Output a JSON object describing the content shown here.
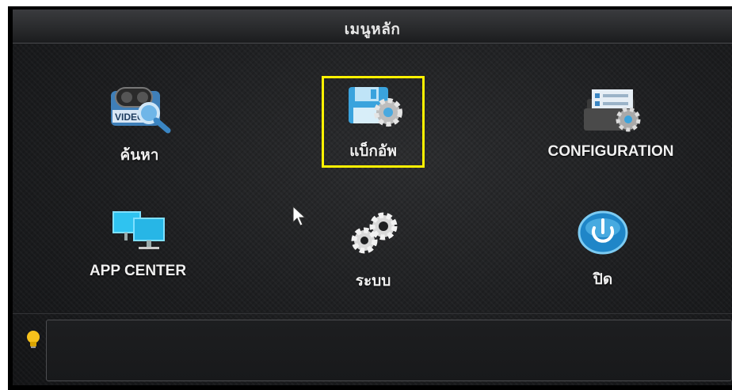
{
  "header": {
    "title": "เมนูหลัก"
  },
  "menu": {
    "items": [
      {
        "label": "ค้นหา"
      },
      {
        "label": "แบ็กอัพ"
      },
      {
        "label": "CONFIGURATION"
      },
      {
        "label": "APP CENTER"
      },
      {
        "label": "ระบบ"
      },
      {
        "label": "ปิด"
      }
    ]
  },
  "icons": {
    "video_search": "video-search-icon",
    "backup": "backup-icon",
    "configuration": "configuration-icon",
    "app_center": "app-center-icon",
    "system": "gears-icon",
    "power": "power-icon",
    "hint": "lightbulb-icon"
  },
  "colors": {
    "highlight": "#fff200",
    "accent_blue": "#2fa8e0",
    "background": "#1d1e20"
  }
}
